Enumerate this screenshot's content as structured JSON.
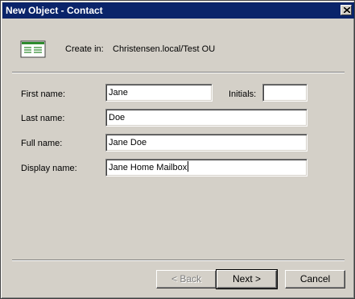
{
  "window": {
    "title": "New Object - Contact"
  },
  "header": {
    "create_in_label": "Create in:",
    "create_in_path": "Christensen.local/Test OU",
    "icon": "contact-card-icon"
  },
  "form": {
    "first_name": {
      "label": "First name:",
      "value": "Jane"
    },
    "initials": {
      "label": "Initials:",
      "value": ""
    },
    "last_name": {
      "label": "Last name:",
      "value": "Doe"
    },
    "full_name": {
      "label": "Full name:",
      "value": "Jane Doe"
    },
    "display_name": {
      "label": "Display name:",
      "value": "Jane Home Mailbox"
    }
  },
  "buttons": {
    "back": "< Back",
    "next": "Next >",
    "cancel": "Cancel"
  },
  "colors": {
    "titlebar": "#0a246a",
    "dialog_bg": "#d4d0c8",
    "icon_green": "#2e8b2e"
  }
}
